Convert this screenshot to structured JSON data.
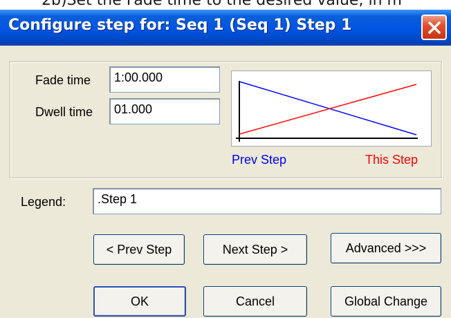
{
  "background_text": "2b)Set the Fade time to the desired value, in m",
  "window": {
    "title": "Configure step for: Seq 1 (Seq 1) Step 1",
    "close_icon": "close-x-icon"
  },
  "fields": {
    "fade_time": {
      "label": "Fade time",
      "value": "1:00.000"
    },
    "dwell_time": {
      "label": "Dwell time",
      "value": "01.000"
    },
    "legend": {
      "label": "Legend:",
      "value": ".Step 1"
    }
  },
  "graph": {
    "prev_label": "Prev Step",
    "this_label": "This Step",
    "prev_color": "#0000ff",
    "this_color": "#ff0000"
  },
  "buttons": {
    "prev_step": "< Prev Step",
    "next_step": "Next Step >",
    "advanced": "Advanced >>>",
    "ok": "OK",
    "cancel": "Cancel",
    "global_change": "Global Change"
  },
  "colors": {
    "titlebar": "#0054e3",
    "dialog_bg": "#ece9d8"
  }
}
